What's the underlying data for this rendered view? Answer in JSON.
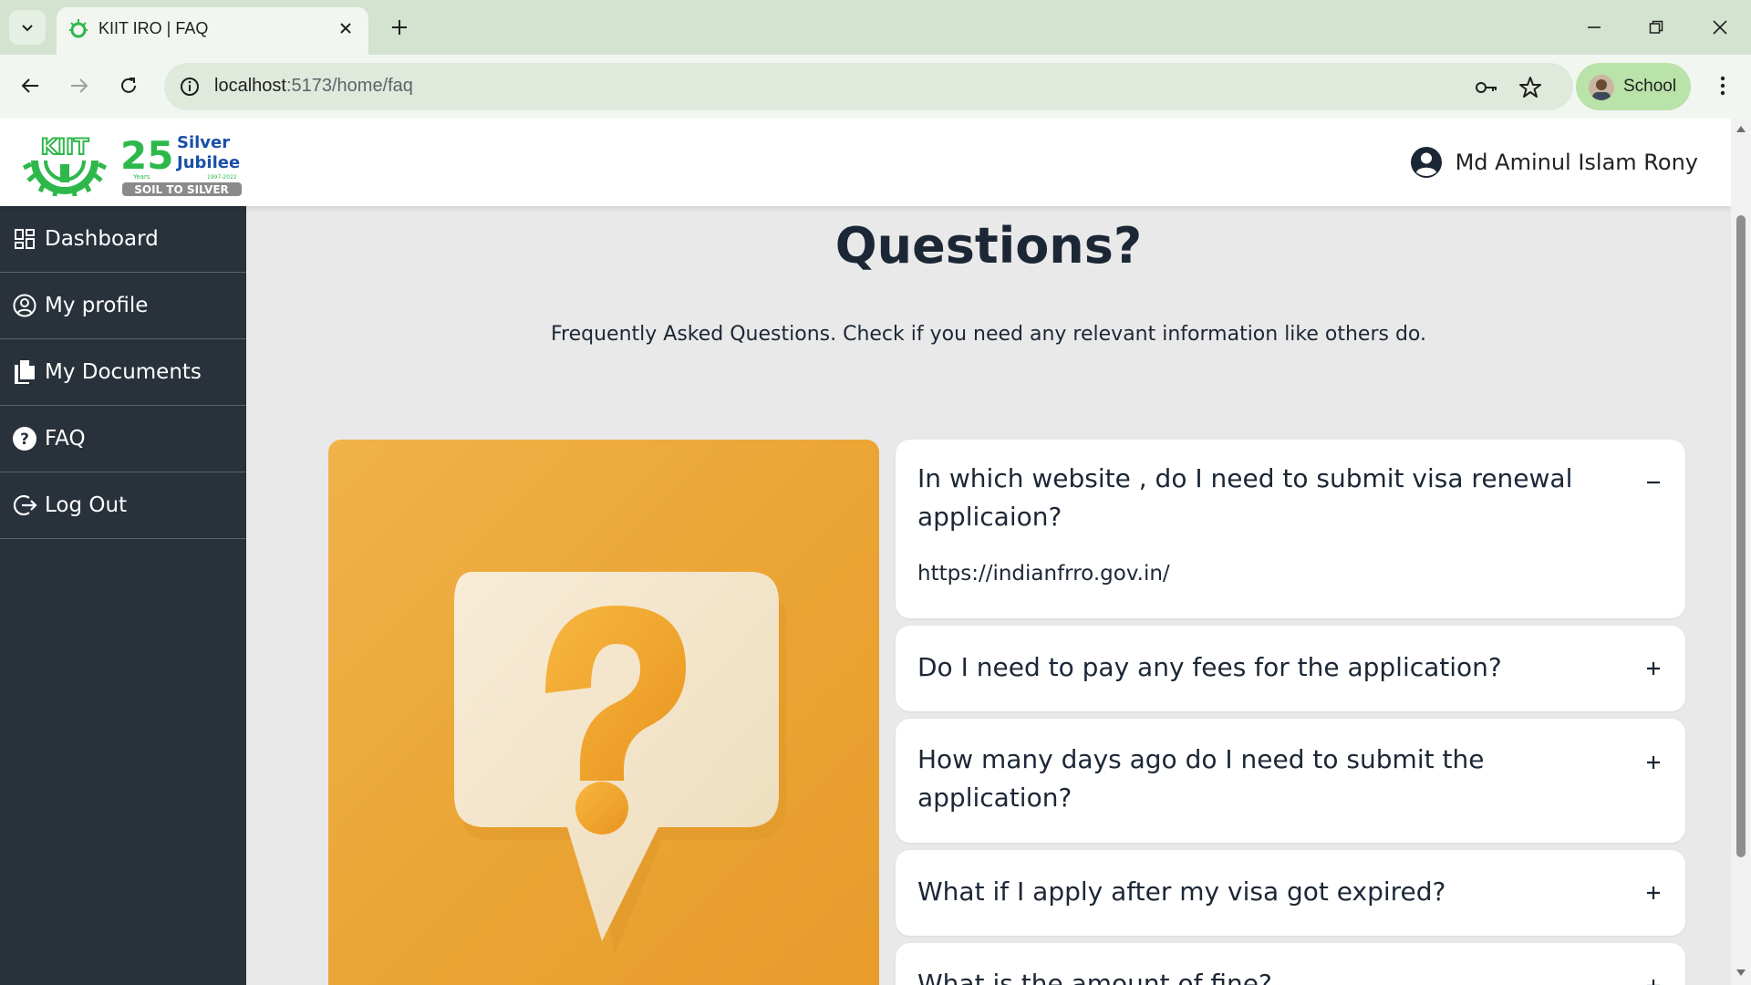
{
  "browser": {
    "tab_title": "KIIT IRO | FAQ",
    "url_host": "localhost",
    "url_path": ":5173/home/faq",
    "profile_name": "School"
  },
  "header": {
    "logo_kiit_text": "KIIT",
    "jubilee_number": "25",
    "jubilee_line1": "Silver",
    "jubilee_line2": "Jubilee",
    "jubilee_years": "Years",
    "jubilee_range": "1997-2022",
    "jubilee_tagline": "SOIL TO SILVER",
    "user_name": "Md Aminul Islam Rony"
  },
  "sidebar": {
    "items": [
      {
        "label": "Dashboard",
        "icon": "dashboard-icon"
      },
      {
        "label": "My profile",
        "icon": "user-circle-icon"
      },
      {
        "label": "My Documents",
        "icon": "documents-icon"
      },
      {
        "label": "FAQ",
        "icon": "question-circle-icon"
      },
      {
        "label": "Log Out",
        "icon": "logout-icon"
      }
    ]
  },
  "main": {
    "title": "Questions?",
    "subtitle": "Frequently Asked Questions. Check if you need any relevant information like others do.",
    "faqs": [
      {
        "question": "In which website , do I need to submit visa renewal applicaion?",
        "answer": "https://indianfrro.gov.in/",
        "expanded": true
      },
      {
        "question": "Do I need to pay any fees for the application?",
        "expanded": false
      },
      {
        "question": "How many days ago do I need to submit the application?",
        "expanded": false
      },
      {
        "question": "What if I apply after my visa got expired?",
        "expanded": false
      },
      {
        "question": "What is the amount of fine?",
        "expanded": false
      }
    ]
  },
  "colors": {
    "sidebar_bg": "#29313b",
    "accent_green": "#2eb84b",
    "illustration_orange": "#eaa433",
    "text_dark": "#1c2736"
  }
}
